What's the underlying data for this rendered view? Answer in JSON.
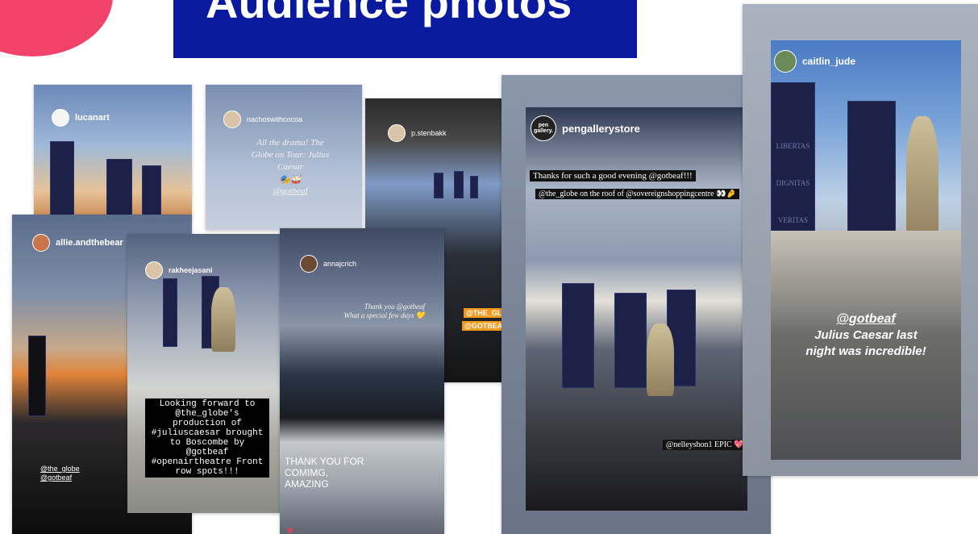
{
  "title": "Audience photos",
  "colors": {
    "title_bg": "#0a1a9e",
    "accent": "#f0426a"
  },
  "cards": {
    "lucanart": {
      "user": "lucanart"
    },
    "nachos": {
      "user": "nachoswithcocoa",
      "caption": "All the drama! The Globe on Tour: Julius Caesar",
      "emoji": "🎭🥁",
      "tag": "@gotbeaf"
    },
    "stenbakk": {
      "user": "p.stenbakk",
      "tag1": "@THE_GLOBE",
      "tag2": "@GOTBEAF"
    },
    "allie": {
      "user": "allie.andthebear",
      "tag1": "@the_globe",
      "tag2": "@gotbeaf"
    },
    "rakhee": {
      "user": "rakheejasani",
      "caption": "Looking forward to @the_globe's production of #juliuscaesar brought to Boscombe by @gotbeaf #openairtheatre Front row spots!!!"
    },
    "anna": {
      "user": "annajcrich",
      "caption1": "Thank you @gotbeaf",
      "caption2": "What a special few days 💛",
      "bottom": "THANK YOU FOR COMIMG, AMAZING"
    },
    "pengallery": {
      "user": "pengallerystore",
      "logo": "pen gallery.",
      "caption1": "Thanks for such a good evening @gotbeaf!!!",
      "caption2": "@the_globe on the roof of @sovereignshoppingcentre 👀🤌",
      "caption3": "@nelleyshon1 EPIC 💖"
    },
    "caitlin": {
      "user": "caitlin_jude",
      "caption1": "@gotbeaf",
      "caption2": "Julius Caesar last",
      "caption3": "night was incredible!",
      "pillar1": "LIBERTAS",
      "pillar2": "DIGNITAS",
      "pillar3": "VERITAS"
    }
  }
}
